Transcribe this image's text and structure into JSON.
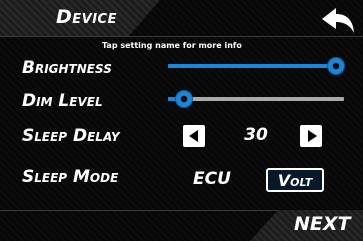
{
  "header": {
    "title": "Device",
    "hint": "Tap setting name for more info",
    "back_icon": "back-arrow-icon"
  },
  "settings": {
    "brightness": {
      "label": "Brightness",
      "level": 1.0
    },
    "dim_level": {
      "label": "Dim Level",
      "level": 0.05
    },
    "sleep_delay": {
      "label": "Sleep Delay",
      "value": "30",
      "left_icon": "arrow-left-icon",
      "right_icon": "arrow-right-icon"
    },
    "sleep_mode": {
      "label": "Sleep Mode",
      "options": [
        "ECU",
        "Volt"
      ],
      "selected": "Volt"
    }
  },
  "footer": {
    "next_label": "NEXT"
  },
  "colors": {
    "accent": "#1b86d9",
    "track": "#a9a9a9",
    "background": "#070707"
  }
}
